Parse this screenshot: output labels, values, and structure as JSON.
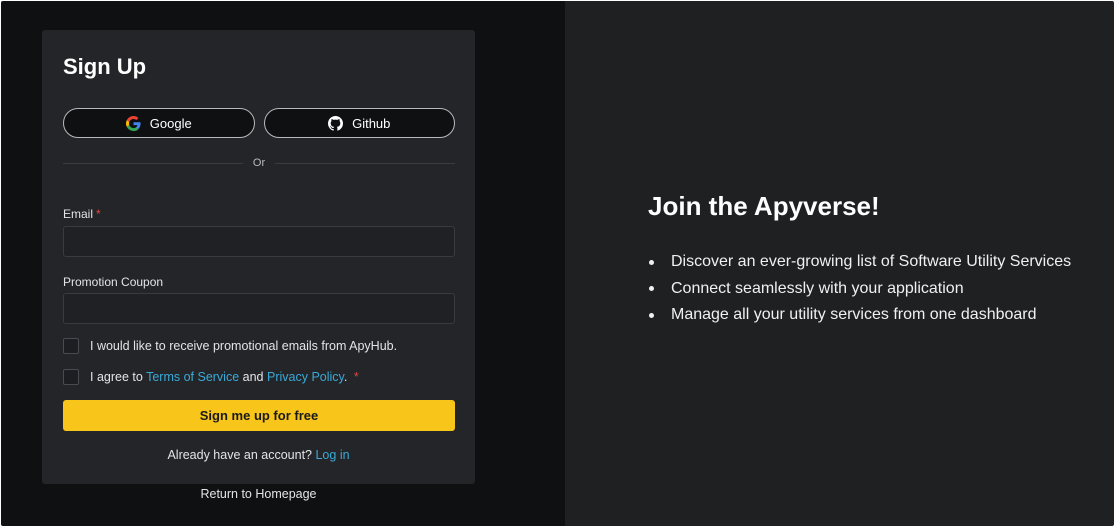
{
  "signup": {
    "title": "Sign Up",
    "google_label": "Google",
    "github_label": "Github",
    "divider_text": "Or",
    "email_label": "Email",
    "email_value": "",
    "coupon_label": "Promotion Coupon",
    "coupon_value": "",
    "required_mark": "*",
    "promo_emails_text": "I would like to receive promotional emails from ApyHub.",
    "agree_prefix": "I agree to",
    "terms_link": "Terms of Service",
    "agree_and": "and",
    "privacy_link": "Privacy Policy",
    "agree_suffix": ".",
    "submit_label": "Sign me up for free",
    "have_account_text": "Already have an account?",
    "login_link": "Log in",
    "homepage_link": "Return to Homepage"
  },
  "promo": {
    "heading": "Join the Apyverse!",
    "features": [
      "Discover an ever-growing list of Software Utility Services",
      "Connect seamlessly with your application",
      "Manage all your utility services from one dashboard"
    ]
  },
  "colors": {
    "accent": "#f8c51b",
    "link": "#3aa9d6",
    "required": "#e2473b",
    "left_bg": "#0f1012",
    "right_bg": "#1f2022",
    "card_bg": "#242529"
  },
  "icons": {
    "google": "google-icon",
    "github": "github-icon"
  }
}
